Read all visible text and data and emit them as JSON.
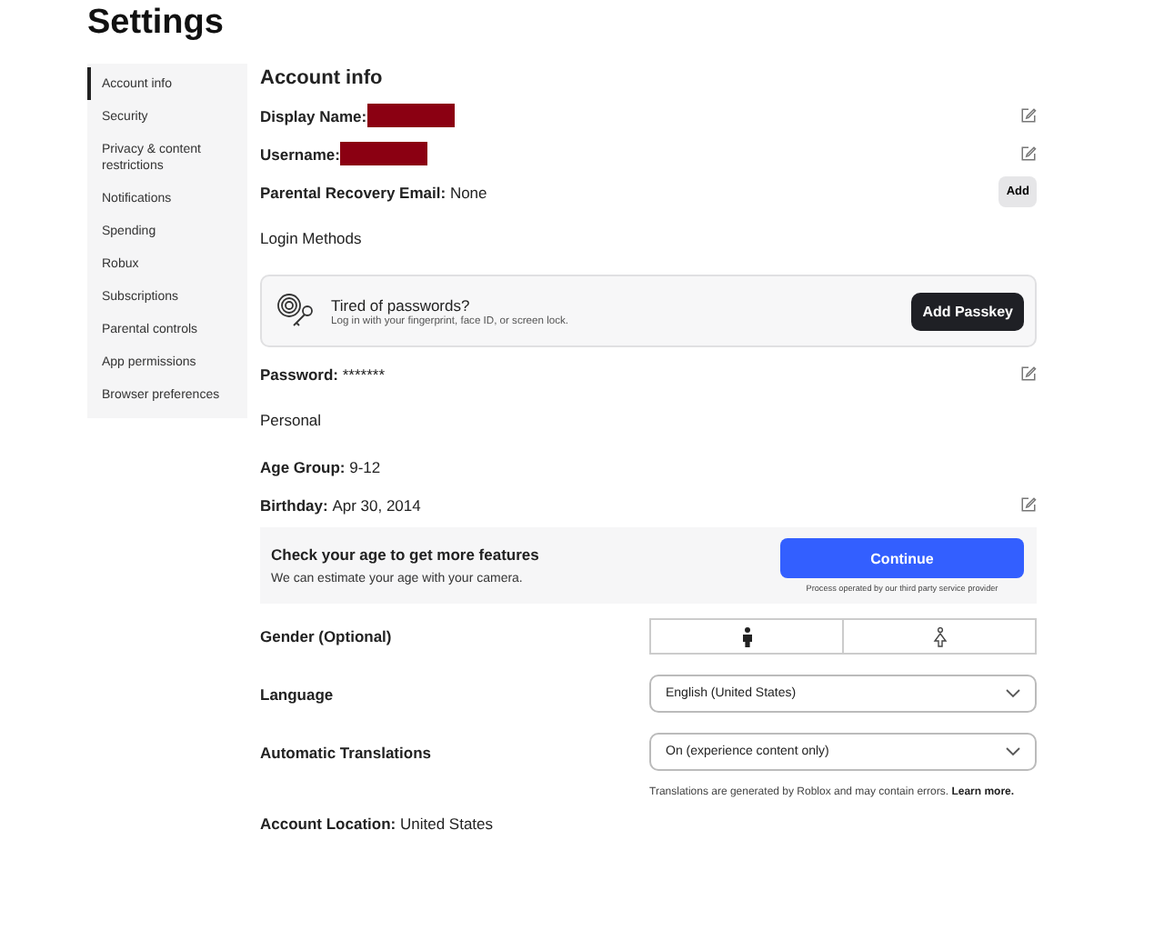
{
  "title": "Settings",
  "sidebar": {
    "items": [
      {
        "label": "Account info",
        "selected": true
      },
      {
        "label": "Security",
        "selected": false
      },
      {
        "label": "Privacy & content restrictions",
        "selected": false
      },
      {
        "label": "Notifications",
        "selected": false
      },
      {
        "label": "Spending",
        "selected": false
      },
      {
        "label": "Robux",
        "selected": false
      },
      {
        "label": "Subscriptions",
        "selected": false
      },
      {
        "label": "Parental controls",
        "selected": false
      },
      {
        "label": "App permissions",
        "selected": false
      },
      {
        "label": "Browser preferences",
        "selected": false
      }
    ]
  },
  "section_title": "Account info",
  "rows": [
    {
      "kind": "field",
      "label": "Display Name:",
      "redacted": true,
      "editable": true
    },
    {
      "kind": "field",
      "label": "Username:",
      "redacted": true,
      "editable": true
    },
    {
      "kind": "field",
      "label": "Parental Recovery Email:",
      "value": "None",
      "add_button": "Add"
    },
    {
      "kind": "heading",
      "label": "Login Methods"
    },
    {
      "kind": "passkey",
      "title": "Tired of passwords?",
      "text": "Log in with your fingerprint, face ID, or screen lock.",
      "button": "Add Passkey"
    },
    {
      "kind": "field",
      "label": "Password:",
      "value": "*******",
      "editable": true
    },
    {
      "kind": "heading",
      "label": "Personal"
    },
    {
      "kind": "field",
      "label": "Age Group:",
      "value": "9-12"
    },
    {
      "kind": "field",
      "label": "Birthday:",
      "value": "Apr 30, 2014",
      "editable": true
    },
    {
      "kind": "age_check",
      "title": "Check your age to get more features",
      "text": "We can estimate your age with your camera.",
      "button": "Continue",
      "note": "Process operated by our third party service provider"
    },
    {
      "kind": "gender",
      "label": "Gender (Optional)"
    },
    {
      "kind": "select",
      "label": "Language",
      "value": "English (United States)"
    },
    {
      "kind": "select",
      "label": "Automatic Translations",
      "value": "On (experience content only)",
      "note": "Translations are generated by Roblox and may contain errors.",
      "link": "Learn more."
    },
    {
      "kind": "field",
      "label": "Account Location:",
      "value": "United States"
    }
  ]
}
